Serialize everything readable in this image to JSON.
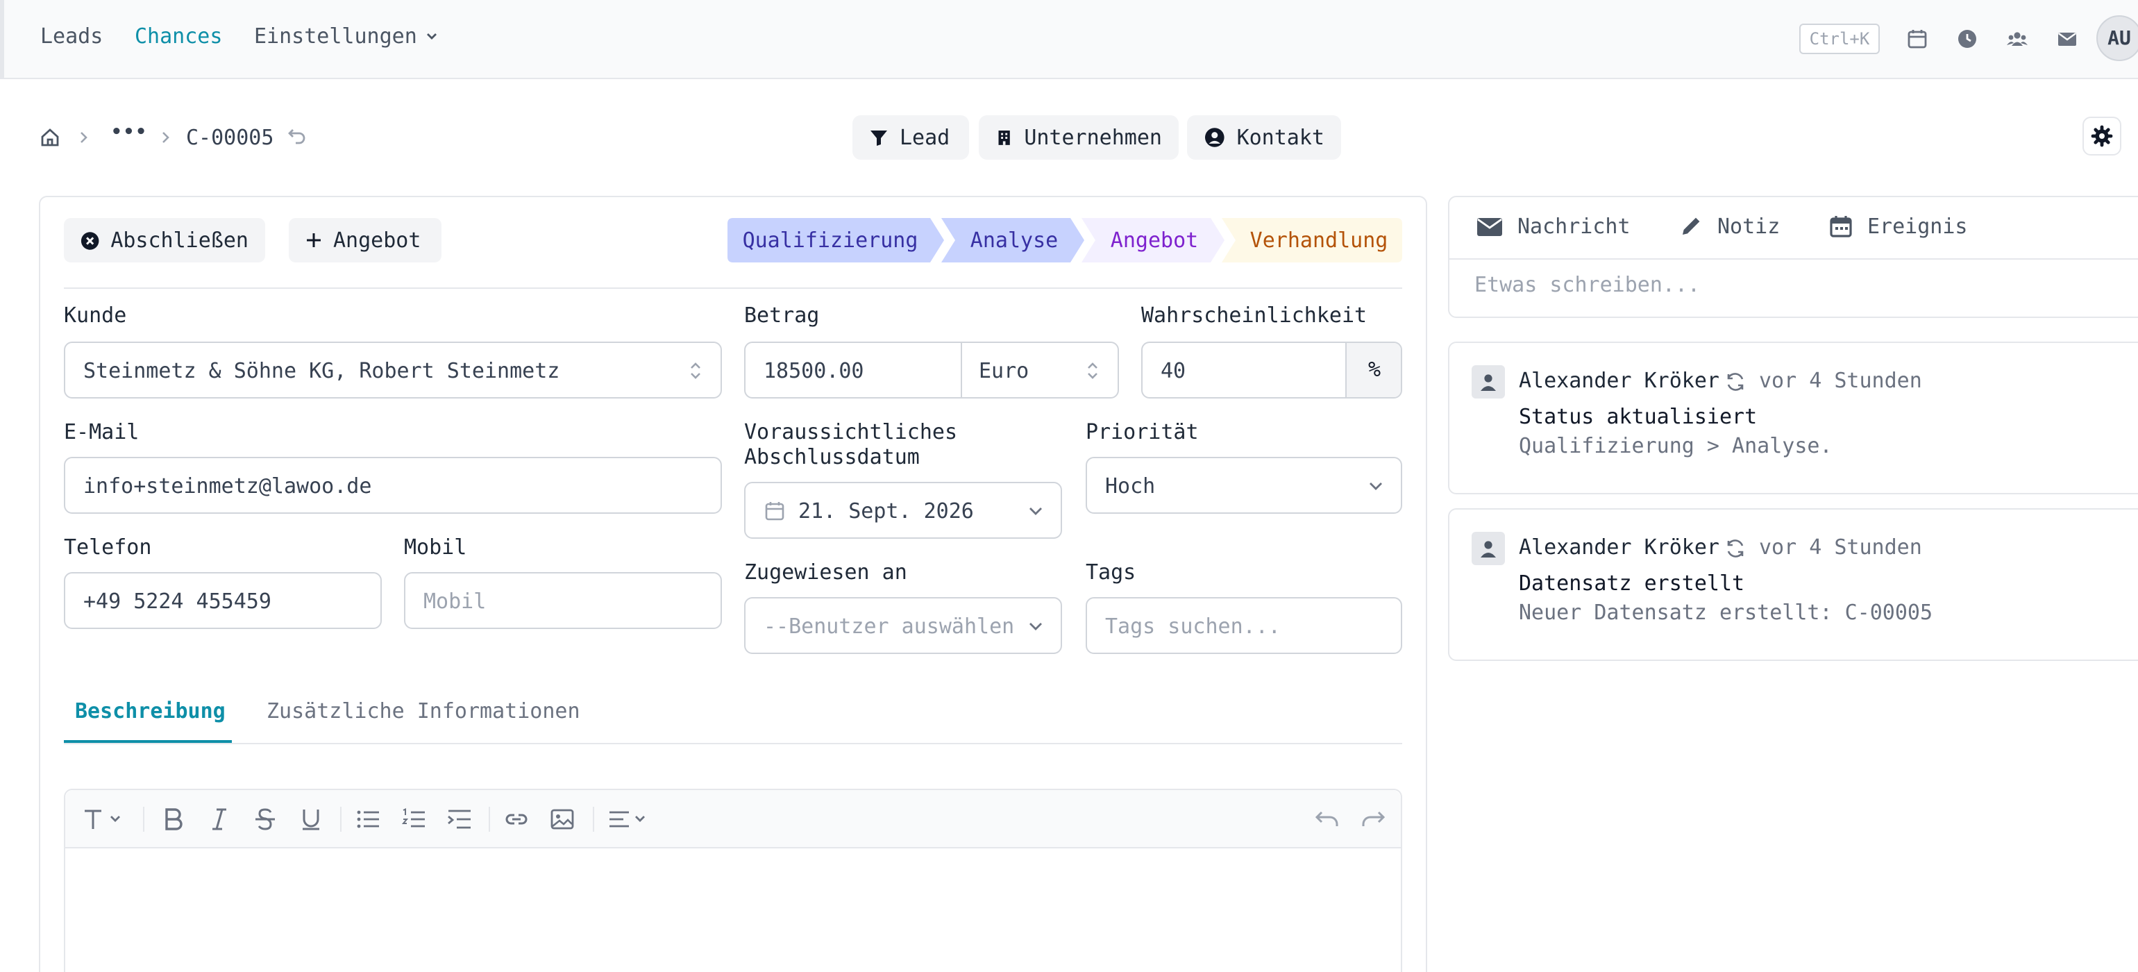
{
  "nav": {
    "leads": "Leads",
    "chances": "Chances",
    "settings": "Einstellungen",
    "shortcut": "Ctrl+K",
    "avatar_initials": "AU",
    "active_color": "#0e8fa8"
  },
  "breadcrumb": {
    "ellipsis": "•••",
    "record_id": "C-00005"
  },
  "header_buttons": {
    "lead": "Lead",
    "company": "Unternehmen",
    "contact": "Kontakt"
  },
  "actions": {
    "close": "Abschließen",
    "quote": "Angebot"
  },
  "stages": [
    {
      "label": "Qualifizierung",
      "bg": "#c7d2fe",
      "color": "#3730a3"
    },
    {
      "label": "Analyse",
      "bg": "#c7d2fe",
      "color": "#3730a3"
    },
    {
      "label": "Angebot",
      "bg": "#f3f0ff",
      "color": "#7e22ce"
    },
    {
      "label": "Verhandlung",
      "bg": "#fef9e7",
      "color": "#b45309"
    }
  ],
  "form": {
    "customer_label": "Kunde",
    "customer_value": "Steinmetz & Söhne KG, Robert Steinmetz",
    "amount_label": "Betrag",
    "amount_value": "18500.00",
    "currency_value": "Euro",
    "probability_label": "Wahrscheinlichkeit",
    "probability_value": "40",
    "probability_unit": "%",
    "email_label": "E-Mail",
    "email_value": "info+steinmetz@lawoo.de",
    "close_date_label": "Voraussichtliches Abschlussdatum",
    "close_date_value": "21. Sept. 2026",
    "priority_label": "Priorität",
    "priority_value": "Hoch",
    "phone_label": "Telefon",
    "phone_value": "+49 5224 455459",
    "mobile_label": "Mobil",
    "mobile_placeholder": "Mobil",
    "assigned_label": "Zugewiesen an",
    "assigned_placeholder": "--Benutzer auswählen",
    "tags_label": "Tags",
    "tags_placeholder": "Tags suchen..."
  },
  "tabs": {
    "description": "Beschreibung",
    "additional": "Zusätzliche Informationen"
  },
  "composer": {
    "message": "Nachricht",
    "note": "Notiz",
    "event": "Ereignis",
    "placeholder": "Etwas schreiben..."
  },
  "activities": [
    {
      "user": "Alexander Kröker",
      "time": "vor 4 Stunden",
      "title": "Status aktualisiert",
      "detail": "Qualifizierung > Analyse."
    },
    {
      "user": "Alexander Kröker",
      "time": "vor 4 Stunden",
      "title": "Datensatz erstellt",
      "detail": "Neuer Datensatz erstellt: C-00005"
    }
  ]
}
